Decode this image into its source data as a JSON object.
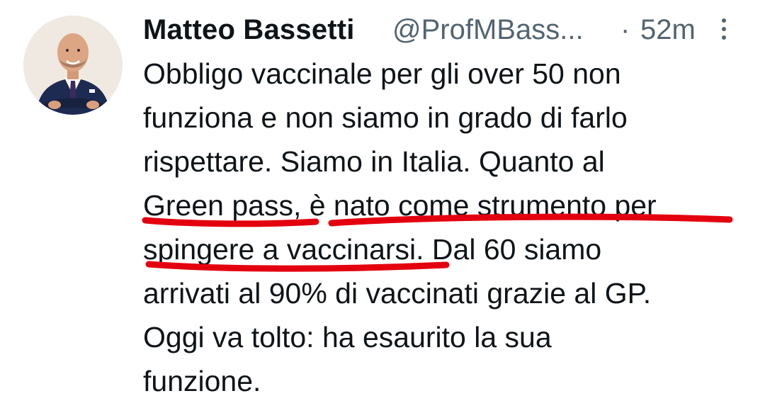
{
  "tweet": {
    "author_name": "Matteo Bassetti",
    "author_handle": "@ProfMBass...",
    "separator": "·",
    "time_ago": "52m",
    "lines": [
      "Obbligo vaccinale per gli over 50 non",
      "funziona e non siamo in grado di farlo",
      "rispettare. Siamo in Italia. Quanto al",
      "Green pass, è nato come strumento per",
      "spingere a vaccinarsi. Dal 60 siamo",
      "arrivati al 90% di vaccinati grazie al GP.",
      "Oggi va tolto: ha esaurito la sua",
      "funzione."
    ]
  },
  "icons": {
    "avatar": "avatar-photo",
    "more": "more-vertical-icon"
  },
  "colors": {
    "text": "#0f1419",
    "secondary": "#536471",
    "annotation": "#e3000f"
  }
}
